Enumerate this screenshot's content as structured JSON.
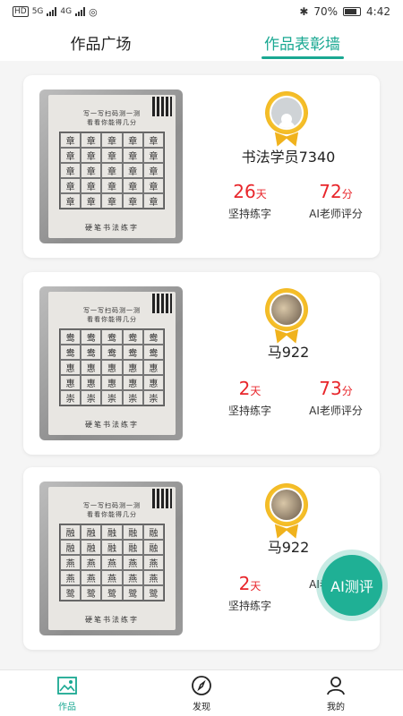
{
  "status_bar": {
    "left_labels": [
      "HD",
      "5G",
      "4G"
    ],
    "battery": "70%",
    "time": "4:42"
  },
  "tabs": [
    {
      "label": "作品广场",
      "active": false
    },
    {
      "label": "作品表彰墙",
      "active": true
    }
  ],
  "colors": {
    "accent": "#1aa892",
    "stat_red": "#e8262b",
    "medal_gold": "#f0b21c"
  },
  "cards": [
    {
      "user_name": "书法学员7340",
      "avatar": "default-user-icon",
      "days_value": "26",
      "days_unit": "天",
      "days_label": "坚持练字",
      "score_value": "72",
      "score_unit": "分",
      "score_label": "AI老师评分",
      "sheet_title_1": "写一写扫码测一测",
      "sheet_title_2": "看看你能得几分",
      "sheet_footer": "硬笔书法练字",
      "grid_chars": [
        "章",
        "章",
        "章",
        "章",
        "章",
        "章",
        "章",
        "章",
        "章",
        "章",
        "章",
        "章",
        "章",
        "章",
        "章",
        "章",
        "章",
        "章",
        "章",
        "章",
        "章",
        "章",
        "章",
        "章",
        "章"
      ]
    },
    {
      "user_name": "马922",
      "avatar": "cat-avatar-icon",
      "days_value": "2",
      "days_unit": "天",
      "days_label": "坚持练字",
      "score_value": "73",
      "score_unit": "分",
      "score_label": "AI老师评分",
      "sheet_title_1": "写一写扫码测一测",
      "sheet_title_2": "看看你能得几分",
      "sheet_footer": "硬笔书法练字",
      "grid_chars": [
        "鸯",
        "鸯",
        "鸯",
        "鸯",
        "鸯",
        "鸯",
        "鸯",
        "鸯",
        "鸯",
        "鸯",
        "惠",
        "惠",
        "惠",
        "惠",
        "惠",
        "惠",
        "惠",
        "惠",
        "惠",
        "惠",
        "崇",
        "崇",
        "崇",
        "崇",
        "崇"
      ]
    },
    {
      "user_name": "马922",
      "avatar": "cat-avatar-icon",
      "days_value": "2",
      "days_unit": "天",
      "days_label": "坚持练字",
      "score_value": "",
      "score_unit": "",
      "score_label": "AI老师评分",
      "sheet_title_1": "写一写扫码测一测",
      "sheet_title_2": "看看你能得几分",
      "sheet_footer": "硬笔书法练字",
      "grid_chars": [
        "融",
        "融",
        "融",
        "融",
        "融",
        "融",
        "融",
        "融",
        "融",
        "融",
        "燕",
        "燕",
        "燕",
        "燕",
        "燕",
        "燕",
        "燕",
        "燕",
        "燕",
        "燕",
        "鹭",
        "鹭",
        "鹭",
        "鹭",
        "鹭"
      ]
    }
  ],
  "ai_button": {
    "label": "AI测评"
  },
  "bottom_nav": [
    {
      "label": "作品",
      "icon": "gallery-icon",
      "active": true
    },
    {
      "label": "发现",
      "icon": "compass-icon",
      "active": false
    },
    {
      "label": "我的",
      "icon": "person-icon",
      "active": false
    }
  ]
}
